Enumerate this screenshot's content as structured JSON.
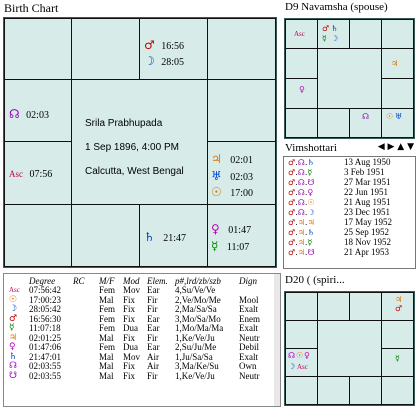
{
  "birth_chart": {
    "title": "Birth Chart",
    "name": "Srila Prabhupada",
    "datetime": "1 Sep 1896, 4:00 PM",
    "place": "Calcutta, West Bengal",
    "houses": {
      "top_right": [
        {
          "glyph": "♂",
          "color": "#c00000",
          "deg": "16:56"
        },
        {
          "glyph": "☽",
          "color": "#0044cc",
          "deg": "28:05"
        }
      ],
      "left_top": [
        {
          "glyph": "☊",
          "color": "#a000c0",
          "deg": "02:03"
        }
      ],
      "asc": {
        "glyph": "Asc",
        "color": "#c00060",
        "deg": "07:56"
      },
      "right_mid": [
        {
          "glyph": "♃",
          "color": "#e07000",
          "deg": "02:01"
        },
        {
          "glyph": "♅",
          "color": "#0044cc",
          "deg": "02:03"
        },
        {
          "glyph": "☉",
          "color": "#e07000",
          "deg": "17:00"
        }
      ],
      "bottom_mid": [
        {
          "glyph": "♄",
          "color": "#0044cc",
          "deg": "21:47"
        }
      ],
      "bottom_right": [
        {
          "glyph": "♀",
          "color": "#c000c0",
          "deg": "01:47"
        },
        {
          "glyph": "☿",
          "color": "#008000",
          "deg": "11:07"
        }
      ]
    }
  },
  "navamsha": {
    "title": "D9 Navamsha  (spouse)",
    "marks": [
      {
        "glyph": "Asc",
        "color": "#c00060"
      },
      {
        "glyph": "♂",
        "color": "#c00000"
      },
      {
        "glyph": "♄",
        "color": "#0044cc"
      },
      {
        "glyph": "☿",
        "color": "#008000"
      },
      {
        "glyph": "☽",
        "color": "#0044cc"
      },
      {
        "glyph": "♃",
        "color": "#e07000"
      },
      {
        "glyph": "♀",
        "color": "#c000c0"
      },
      {
        "glyph": "☊",
        "color": "#a000c0"
      },
      {
        "glyph": "☉",
        "color": "#e07000"
      },
      {
        "glyph": "♅",
        "color": "#0044cc"
      }
    ]
  },
  "vimshottari": {
    "title": "Vimshottari",
    "rows": [
      {
        "date": "13 Aug 1950"
      },
      {
        "date": "3 Feb 1951"
      },
      {
        "date": "27 Mar 1951"
      },
      {
        "date": "22 Jun 1951"
      },
      {
        "date": "21 Aug 1951"
      },
      {
        "date": "23 Dec 1951"
      },
      {
        "date": "17 May 1952"
      },
      {
        "date": "25 Sep 1952"
      },
      {
        "date": "18 Nov 1952"
      },
      {
        "date": "21 Apr 1953"
      }
    ]
  },
  "d20": {
    "title": "D20 ( (spiri..."
  },
  "planet_table": {
    "headers": [
      "Degree",
      "RC",
      "M/F",
      "Mod",
      "Elem.",
      "p#,lrd/zb/szb",
      "Dign"
    ],
    "rows": [
      {
        "glyph": "Asc",
        "color": "#c00060",
        "deg": "07:56:42",
        "rc": "",
        "mf": "Fem",
        "mod": "Mov",
        "elem": "Ear",
        "lord": "4,Su/Ve/Ve",
        "dign": ""
      },
      {
        "glyph": "☉",
        "color": "#e07000",
        "deg": "17:00:23",
        "rc": "",
        "mf": "Mal",
        "mod": "Fix",
        "elem": "Fir",
        "lord": "2,Ve/Mo/Me",
        "dign": "Mool"
      },
      {
        "glyph": "☽",
        "color": "#0044cc",
        "deg": "28:05:42",
        "rc": "",
        "mf": "Fem",
        "mod": "Fix",
        "elem": "Fir",
        "lord": "2,Ma/Sa/Sa",
        "dign": "Exalt"
      },
      {
        "glyph": "♂",
        "color": "#c00000",
        "deg": "16:56:30",
        "rc": "",
        "mf": "Fem",
        "mod": "Fix",
        "elem": "Ear",
        "lord": "3,Mo/Sa/Mo",
        "dign": "Enem"
      },
      {
        "glyph": "☿",
        "color": "#008000",
        "deg": "11:07:18",
        "rc": "",
        "mf": "Fem",
        "mod": "Dua",
        "elem": "Ear",
        "lord": "1,Mo/Ma/Ma",
        "dign": "Exalt"
      },
      {
        "glyph": "♃",
        "color": "#e07000",
        "deg": "02:01:25",
        "rc": "",
        "mf": "Mal",
        "mod": "Fix",
        "elem": "Fir",
        "lord": "1,Ke/Ve/Ju",
        "dign": "Neutr"
      },
      {
        "glyph": "♀",
        "color": "#c000c0",
        "deg": "01:47:06",
        "rc": "",
        "mf": "Fem",
        "mod": "Dua",
        "elem": "Ear",
        "lord": "2,Su/Ju/Me",
        "dign": "Debil"
      },
      {
        "glyph": "♄",
        "color": "#0044cc",
        "deg": "21:47:01",
        "rc": "",
        "mf": "Mal",
        "mod": "Mov",
        "elem": "Air",
        "lord": "1,Ju/Sa/Sa",
        "dign": "Exalt"
      },
      {
        "glyph": "☊",
        "color": "#a000c0",
        "deg": "02:03:55",
        "rc": "",
        "mf": "Mal",
        "mod": "Fix",
        "elem": "Air",
        "lord": "3,Ma/Ke/Su",
        "dign": "Own"
      },
      {
        "glyph": "☋",
        "color": "#a000c0",
        "deg": "02:03:55",
        "rc": "",
        "mf": "Mal",
        "mod": "Fix",
        "elem": "Fir",
        "lord": "1,Ke/Ve/Ju",
        "dign": "Neutr"
      }
    ]
  }
}
